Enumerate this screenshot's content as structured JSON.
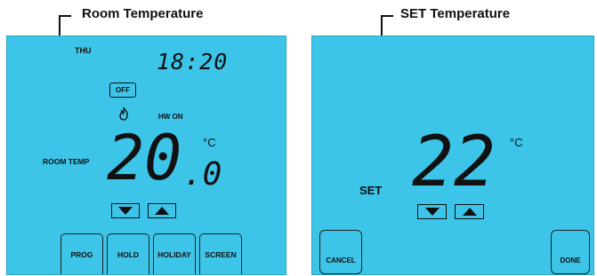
{
  "callouts": {
    "room": "Room Temperature",
    "set": "SET Temperature"
  },
  "left_screen": {
    "day": "THU",
    "time": "18:20",
    "off_label": "OFF",
    "flame_icon": "flame-icon",
    "hw_status": "HW ON",
    "room_label": "ROOM TEMP",
    "temp_main": "20",
    "temp_decimal": ".0",
    "unit": "°C",
    "buttons": [
      "PROG",
      "HOLD",
      "HOLIDAY",
      "SCREEN"
    ]
  },
  "right_screen": {
    "set_label": "SET",
    "temp": "22",
    "unit": "°C",
    "cancel": "CANCEL",
    "done": "DONE"
  },
  "colors": {
    "screen": "#3cc5e8",
    "ink": "#111111"
  }
}
